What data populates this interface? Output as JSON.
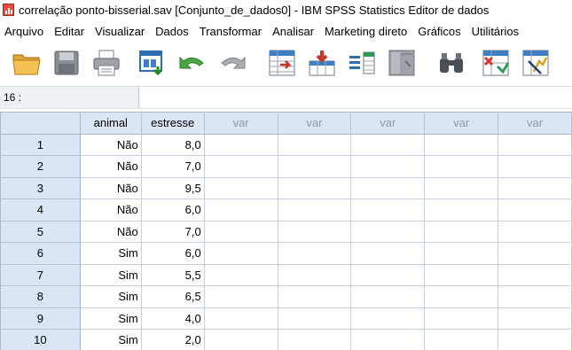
{
  "window": {
    "title": "correlação ponto-bisserial.sav [Conjunto_de_dados0] - IBM SPSS Statistics Editor de dados"
  },
  "menu": [
    {
      "label": "Arquivo",
      "name": "menu-arquivo"
    },
    {
      "label": "Editar",
      "name": "menu-editar"
    },
    {
      "label": "Visualizar",
      "name": "menu-visualizar"
    },
    {
      "label": "Dados",
      "name": "menu-dados"
    },
    {
      "label": "Transformar",
      "name": "menu-transformar"
    },
    {
      "label": "Analisar",
      "name": "menu-analisar"
    },
    {
      "label": "Marketing direto",
      "name": "menu-marketing-direto"
    },
    {
      "label": "Gráficos",
      "name": "menu-graficos"
    },
    {
      "label": "Utilitários",
      "name": "menu-utilitarios"
    }
  ],
  "toolbar": {
    "icons": [
      "open-folder-icon",
      "save-icon",
      "print-icon",
      "recall-dialog-icon",
      "undo-icon",
      "redo-icon",
      "goto-case-icon",
      "goto-variable-icon",
      "variables-icon",
      "run-descriptives-icon",
      "find-icon",
      "insert-cases-icon",
      "split-file-icon"
    ]
  },
  "cellbar": {
    "reference": "16 :",
    "value": ""
  },
  "grid": {
    "columns": [
      "animal",
      "estresse",
      "var",
      "var",
      "var",
      "var",
      "var"
    ],
    "rows": [
      {
        "num": "1",
        "animal": "Não",
        "estresse": "8,0"
      },
      {
        "num": "2",
        "animal": "Não",
        "estresse": "7,0"
      },
      {
        "num": "3",
        "animal": "Não",
        "estresse": "9,5"
      },
      {
        "num": "4",
        "animal": "Não",
        "estresse": "6,0"
      },
      {
        "num": "5",
        "animal": "Não",
        "estresse": "7,0"
      },
      {
        "num": "6",
        "animal": "Sim",
        "estresse": "6,0"
      },
      {
        "num": "7",
        "animal": "Sim",
        "estresse": "5,5"
      },
      {
        "num": "8",
        "animal": "Sim",
        "estresse": "6,5"
      },
      {
        "num": "9",
        "animal": "Sim",
        "estresse": "4,0"
      },
      {
        "num": "10",
        "animal": "Sim",
        "estresse": "2,0"
      }
    ]
  },
  "colors": {
    "header_bg": "#dbe6f4",
    "grid_line": "#c8d0dc",
    "var_text": "#8f9aa8"
  }
}
